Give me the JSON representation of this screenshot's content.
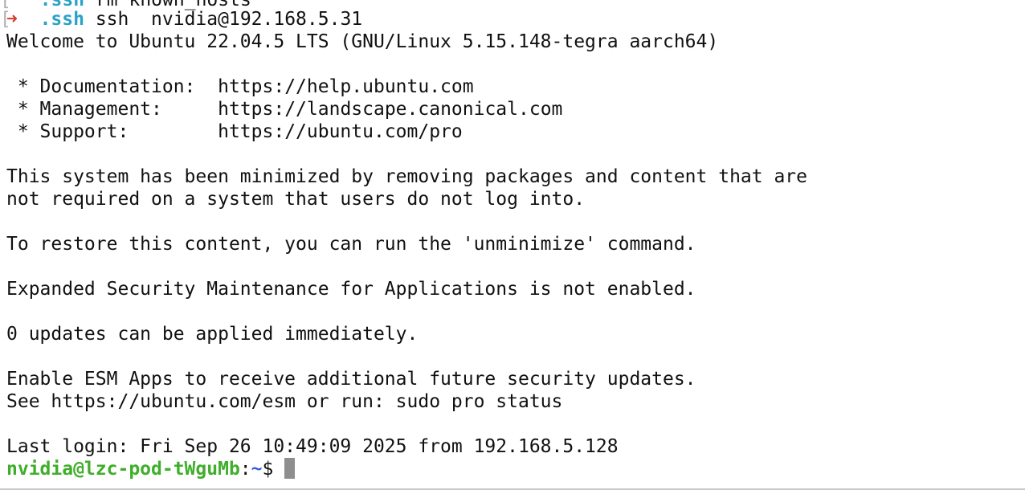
{
  "top_partial": {
    "dir": ".ssh",
    "text": " rm known_hosts"
  },
  "command_line": {
    "arrow": "➜",
    "dir": ".ssh",
    "command": "ssh  nvidia@192.168.5.31"
  },
  "welcome": "Welcome to Ubuntu 22.04.5 LTS (GNU/Linux 5.15.148-tegra aarch64)",
  "links": [
    {
      "label": " * Documentation:",
      "url": "https://help.ubuntu.com"
    },
    {
      "label": " * Management:",
      "url": "https://landscape.canonical.com"
    },
    {
      "label": " * Support:",
      "url": "https://ubuntu.com/pro"
    }
  ],
  "minimized_1": "This system has been minimized by removing packages and content that are",
  "minimized_2": "not required on a system that users do not log into.",
  "restore": "To restore this content, you can run the 'unminimize' command.",
  "esm_notice": "Expanded Security Maintenance for Applications is not enabled.",
  "updates": "0 updates can be applied immediately.",
  "esm_enable": "Enable ESM Apps to receive additional future security updates.",
  "esm_see": "See https://ubuntu.com/esm or run: sudo pro status",
  "last_login": "Last login: Fri Sep 26 10:49:09 2025 from 192.168.5.128",
  "prompt": {
    "user_host": "nvidia@lzc-pod-tWguMb",
    "sep": ":",
    "path": "~",
    "symbol": "$ "
  },
  "colors": {
    "arrow": "#d43a2a",
    "dir": "#2aa3c8",
    "user": "#3fae2a",
    "path": "#3a5fd6",
    "cursor": "#8e8e8e"
  }
}
